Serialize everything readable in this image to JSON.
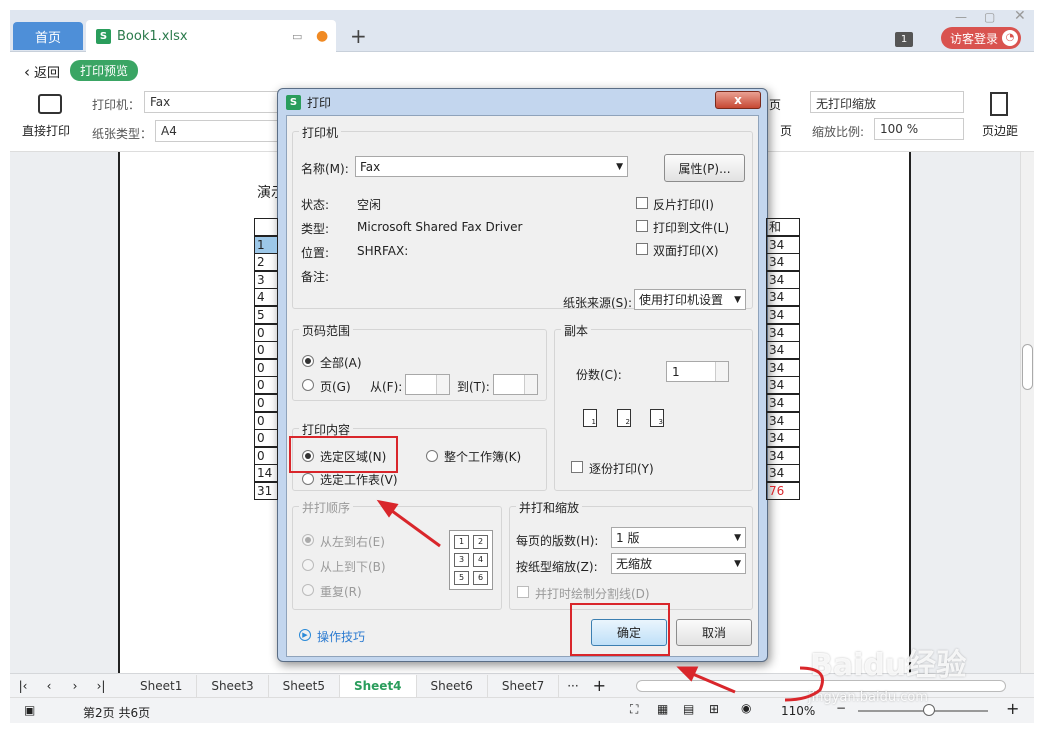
{
  "tabs": {
    "home": "首页",
    "file": "Book1.xlsx",
    "new_tab": "+",
    "badge": "1",
    "login": "访客登录"
  },
  "toolbar": {
    "back": "返回",
    "mode": "打印预览",
    "direct_print": "直接打印",
    "printer_label": "打印机：",
    "printer_value": "Fax",
    "paper_label": "纸张类型：",
    "paper_value": "A4",
    "scale_mode": "无打印缩放",
    "scale_label": "缩放比例:",
    "scale_value": "100 %",
    "margins": "页边距",
    "page_partial": "页"
  },
  "sheet": {
    "title_partial": "演示",
    "header_right": "和",
    "left_col": [
      "1",
      "2",
      "3",
      "4",
      "5",
      "0",
      "0",
      "0",
      "0",
      "0",
      "0",
      "0",
      "0",
      "14",
      "31"
    ],
    "right_col": [
      "34",
      "34",
      "34",
      "34",
      "34",
      "34",
      "34",
      "34",
      "34",
      "34",
      "34",
      "34",
      "34",
      "34",
      "76"
    ]
  },
  "dialog": {
    "title": "打印",
    "close": "x",
    "printer_group": "打印机",
    "name_label": "名称(M):",
    "name_value": "Fax",
    "properties_button": "属性(P)...",
    "status_label": "状态:",
    "status_value": "空闲",
    "type_label": "类型:",
    "type_value": "Microsoft Shared Fax Driver",
    "location_label": "位置:",
    "location_value": "SHRFAX:",
    "comment_label": "备注:",
    "reverse_print": "反片打印(I)",
    "print_to_file": "打印到文件(L)",
    "duplex": "双面打印(X)",
    "paper_source_label": "纸张来源(S):",
    "paper_source_value": "使用打印机设置",
    "page_range_group": "页码范围",
    "all_pages": "全部(A)",
    "pages": "页(G)",
    "from_label": "从(F):",
    "to_label": "到(T):",
    "copies_group": "副本",
    "copies_label": "份数(C):",
    "copies_value": "1",
    "collate": "逐份打印(Y)",
    "content_group": "打印内容",
    "selection": "选定区域(N)",
    "whole_workbook": "整个工作簿(K)",
    "selected_sheets": "选定工作表(V)",
    "order_group": "并打顺序",
    "left_to_right": "从左到右(E)",
    "top_to_bottom": "从上到下(B)",
    "repeat": "重复(R)",
    "zoom_group": "并打和缩放",
    "pages_per_sheet_label": "每页的版数(H):",
    "pages_per_sheet_value": "1 版",
    "scale_to_paper_label": "按纸型缩放(Z):",
    "scale_to_paper_value": "无缩放",
    "draw_dividers": "并打时绘制分割线(D)",
    "tips": "操作技巧",
    "ok": "确定",
    "cancel": "取消",
    "order_numbers": [
      "1",
      "2",
      "3",
      "4",
      "5",
      "6"
    ],
    "copy_numbers": [
      "1",
      "2",
      "3"
    ]
  },
  "sheet_tabs": [
    "Sheet1",
    "Sheet3",
    "Sheet5",
    "Sheet4",
    "Sheet6",
    "Sheet7"
  ],
  "active_sheet": "Sheet4",
  "status": {
    "page_info": "第2页 共6页",
    "zoom": "110%"
  },
  "watermark": {
    "brand": "Baidu经验",
    "url": "jingyan.baidu.com"
  },
  "colors": {
    "accent": "#3aa564",
    "red_highlight": "#d9262b",
    "home_tab": "#4e8fd8"
  }
}
